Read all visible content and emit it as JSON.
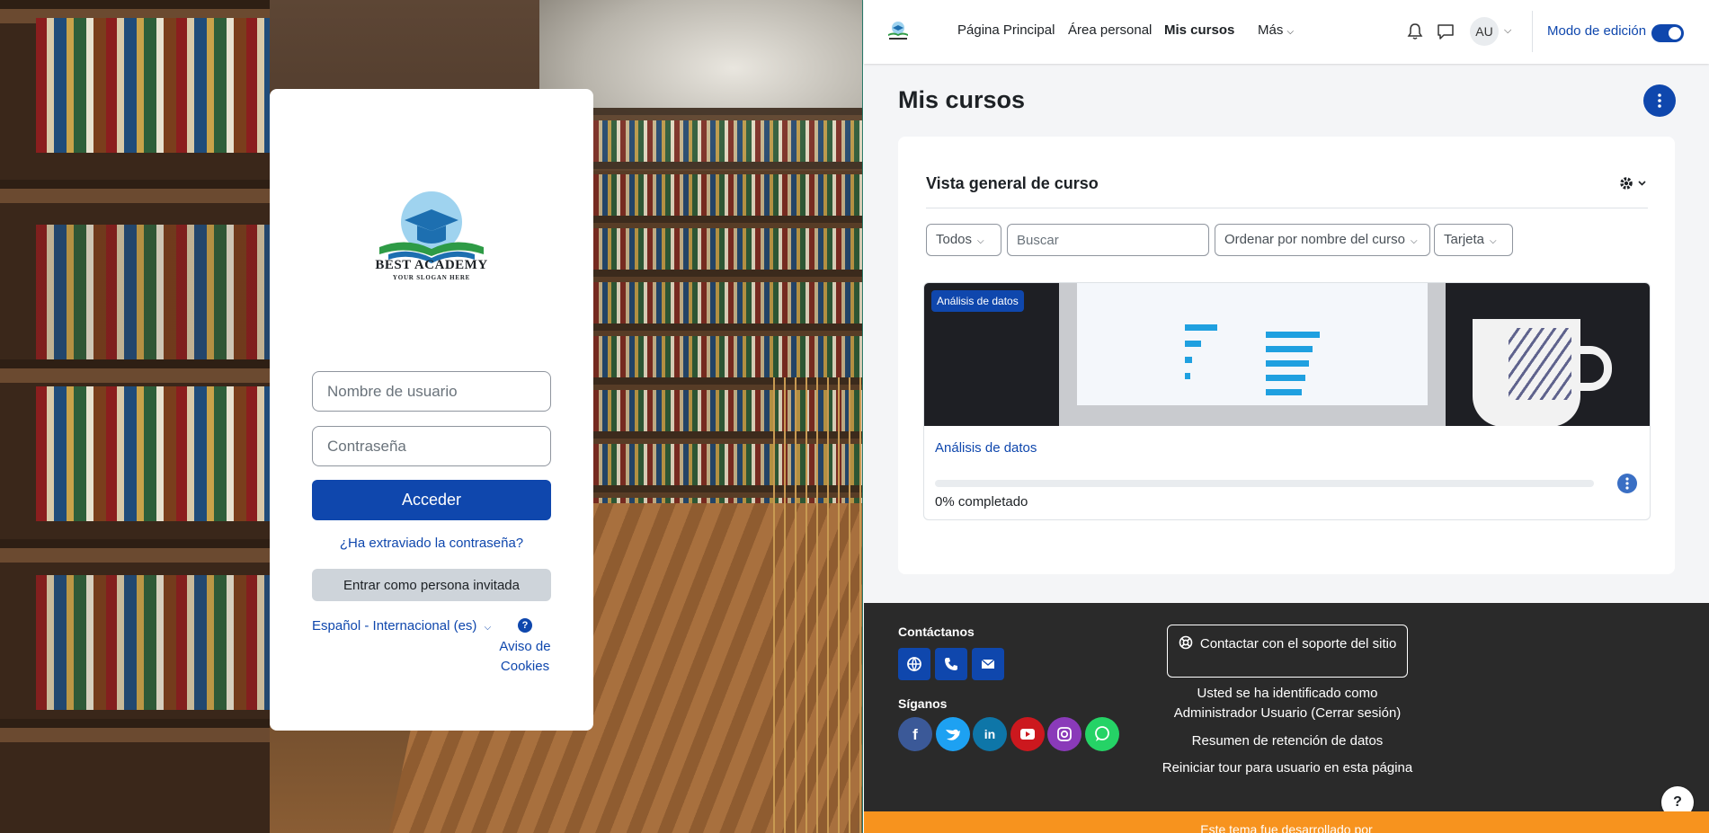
{
  "login": {
    "logo_title": "BEST ACADEMY",
    "logo_slogan": "YOUR SLOGAN HERE",
    "username_placeholder": "Nombre de usuario",
    "password_placeholder": "Contraseña",
    "login_button": "Acceder",
    "forgot_password": "¿Ha extraviado la contraseña?",
    "guest_button": "Entrar como persona invitada",
    "language": "Español - Internacional (es)",
    "cookie_help": "?",
    "cookie_notice": "Aviso de Cookies"
  },
  "nav": {
    "items": [
      {
        "label": "Página Principal"
      },
      {
        "label": "Área personal"
      },
      {
        "label": "Mis cursos"
      },
      {
        "label": "Más"
      }
    ],
    "active_item": "Mis cursos",
    "avatar_initials": "AU",
    "edit_mode_label": "Modo de edición",
    "edit_mode_on": true
  },
  "page": {
    "title": "Mis cursos"
  },
  "overview": {
    "title": "Vista general de curso",
    "filter_all": "Todos",
    "search_placeholder": "Buscar",
    "sort_label": "Ordenar por nombre del curso",
    "view_label": "Tarjeta"
  },
  "course": {
    "badge": "Análisis de datos",
    "name": "Análisis de datos",
    "progress_percent": 0,
    "progress_label": "0% completado"
  },
  "footer": {
    "contact_heading": "Contáctanos",
    "follow_heading": "Síganos",
    "support_button": "Contactar con el soporte del sitio",
    "logged_in_text": "Usted se ha identificado como Administrador Usuario (Cerrar sesión)",
    "data_retention": "Resumen de retención de datos",
    "reset_tour": "Reiniciar tour para usuario en esta página",
    "help_label": "?",
    "theme_credit": "Este tema fue desarrollado por"
  },
  "colors": {
    "primary": "#0f47ad",
    "footer_bg": "#2a2a2a",
    "orange": "#f7931e",
    "facebook": "#3b5998",
    "twitter": "#1da1f2",
    "linkedin": "#0e76a8",
    "youtube": "#cc181e",
    "instagram": "#8a3ab9",
    "whatsapp": "#25d366"
  },
  "icons": {
    "contact": [
      "globe-icon",
      "phone-icon",
      "envelope-icon"
    ],
    "social": [
      "facebook-icon",
      "twitter-icon",
      "linkedin-icon",
      "youtube-icon",
      "instagram-icon",
      "whatsapp-icon"
    ]
  }
}
